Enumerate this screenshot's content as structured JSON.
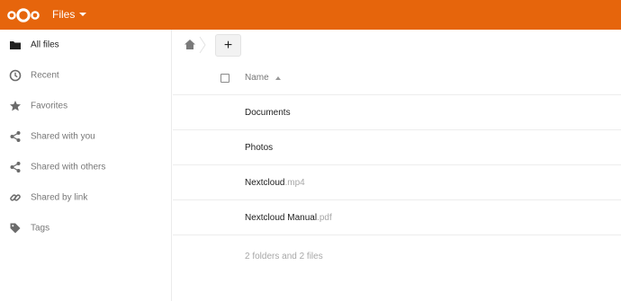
{
  "app": {
    "title": "Files"
  },
  "colors": {
    "brand": "#e6650c"
  },
  "sidebar": {
    "items": [
      {
        "label": "All files",
        "icon": "folder-icon",
        "active": true
      },
      {
        "label": "Recent",
        "icon": "clock-icon",
        "active": false
      },
      {
        "label": "Favorites",
        "icon": "star-icon",
        "active": false
      },
      {
        "label": "Shared with you",
        "icon": "share-icon",
        "active": false
      },
      {
        "label": "Shared with others",
        "icon": "share-icon",
        "active": false
      },
      {
        "label": "Shared by link",
        "icon": "link-icon",
        "active": false
      },
      {
        "label": "Tags",
        "icon": "tag-icon",
        "active": false
      }
    ]
  },
  "toolbar": {
    "new_label": "+"
  },
  "list": {
    "column_name": "Name",
    "sort": "ascending",
    "files": [
      {
        "name": "Documents",
        "ext": "",
        "type": "folder"
      },
      {
        "name": "Photos",
        "ext": "",
        "type": "folder"
      },
      {
        "name": "Nextcloud",
        "ext": ".mp4",
        "type": "file"
      },
      {
        "name": "Nextcloud Manual",
        "ext": ".pdf",
        "type": "file"
      }
    ],
    "summary": "2 folders and 2 files"
  }
}
